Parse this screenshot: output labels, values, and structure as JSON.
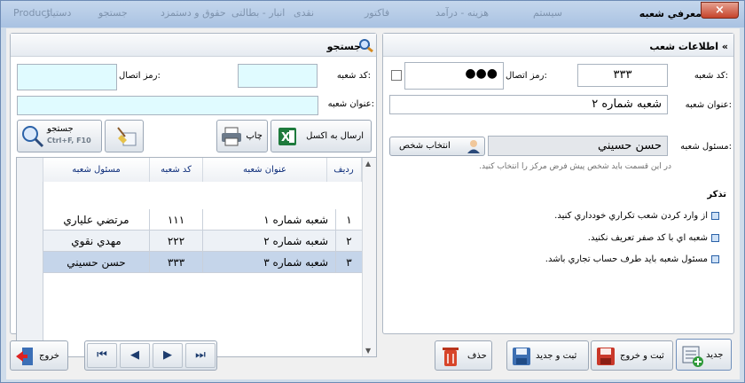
{
  "titlebar": {
    "title": "معرفي شعبه",
    "ghost": [
      "دستیار",
      "حقوق و دستمزد",
      "انبار - بطالتی",
      "نقدی",
      "فاکتور",
      "هزینه - درآمد",
      "سیستم",
      "جستجو",
      "Product"
    ],
    "close": "×"
  },
  "info_panel": {
    "header": "» اطلاعات شعب",
    "branch_code_label": "كد شعبه:",
    "branch_code_value": "٣٣٣",
    "contact_code_label": "رمز اتصال:",
    "contact_code_value": "●●●",
    "branch_title_label": "عنوان شعبه:",
    "branch_title_value": "شعبه شماره ٢",
    "manager_label": "مسئول شعبه:",
    "manager_value": "حسن حسيني",
    "select_person_button": "انتخاب شخص",
    "hint": "در اين قسمت بايد شخص پيش فرض مركز را انتخاب كنيد.",
    "notes_title": "تذكر",
    "notes": [
      "از وارد كردن شعب تكراري خودداري كنيد.",
      "شعبه اي با كد صفر تعريف نكنيد.",
      "مسئول شعبه بايد طرف حساب تجاري باشد."
    ]
  },
  "search_panel": {
    "header": "» جستجو",
    "branch_code_label": "كد شعبه:",
    "contact_code_label": "رمز اتصال:",
    "branch_title_label": "عنوان شعبه:",
    "excel_button": "ارسال به اكسل",
    "print_button": "چاپ",
    "search_button": "جستجو",
    "search_shortcut": "Ctrl+F, F10"
  },
  "grid": {
    "columns": [
      "رديف",
      "عنوان شعبه",
      "كد شعبه",
      "مسئول شعبه"
    ],
    "rows": [
      {
        "num": "١",
        "title": "شعبه شماره ١",
        "code": "١١١",
        "manager": "مرتضي علياري"
      },
      {
        "num": "٢",
        "title": "شعبه شماره ٢",
        "code": "٢٢٢",
        "manager": "مهدي نقوي"
      },
      {
        "num": "٣",
        "title": "شعبه شماره ٣",
        "code": "٣٣٣",
        "manager": "حسن حسيني"
      }
    ]
  },
  "footer": {
    "new": "جديد",
    "save_exit": "ثبت و خروج",
    "save_new": "ثبت و جديد",
    "delete": "حذف",
    "exit": "خروج"
  },
  "colors": {
    "accent": "#2b62a8",
    "selected_row": "#c5d5ea",
    "cyan_field": "#e0fbff"
  }
}
